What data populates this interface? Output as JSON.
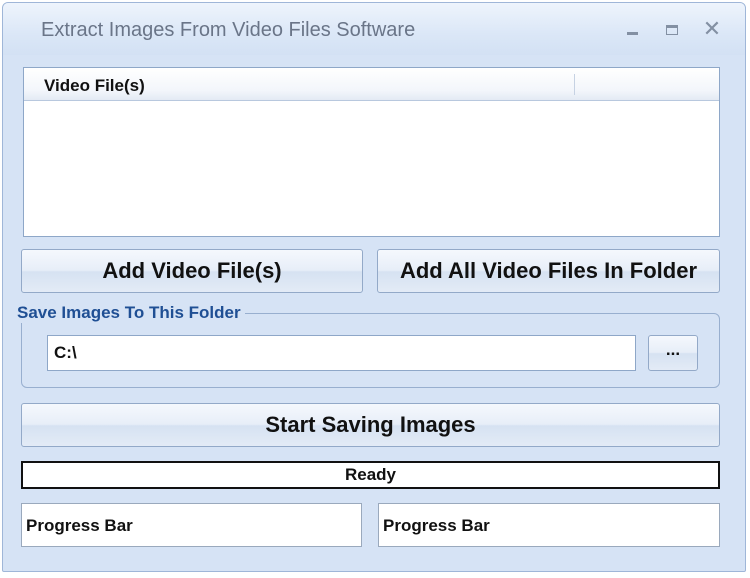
{
  "window": {
    "title": "Extract Images From Video Files Software",
    "minimize_icon": "minimize-icon",
    "maximize_icon": "maximize-icon",
    "close_icon": "close-icon",
    "close_glyph": "✕"
  },
  "video_list": {
    "columns": [
      "Video File(s)",
      ""
    ],
    "rows": []
  },
  "buttons": {
    "add_video_files": "Add Video File(s)",
    "add_all_in_folder": "Add All Video Files In Folder",
    "browse": "...",
    "start_saving": "Start Saving Images"
  },
  "save_folder": {
    "legend": "Save Images To This Folder",
    "value": "C:\\"
  },
  "status": {
    "text": "Ready"
  },
  "progress": {
    "bar1_label": "Progress Bar",
    "bar2_label": "Progress Bar"
  },
  "colors": {
    "window_bg": "#d6e3f5",
    "legend_text": "#1f4f94",
    "title_text": "#6a7588"
  }
}
